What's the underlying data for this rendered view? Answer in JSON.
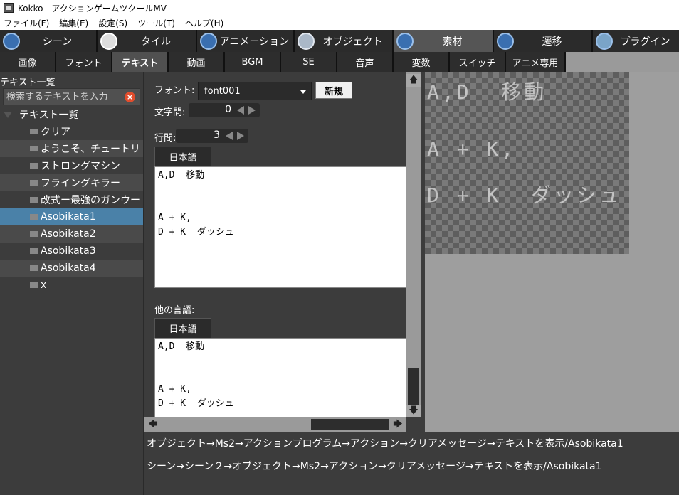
{
  "window": {
    "title": "Kokko - アクションゲームツクールMV"
  },
  "menu": [
    "ファイル(F)",
    "編集(E)",
    "設定(S)",
    "ツール(T)",
    "ヘルプ(H)"
  ],
  "main_tabs": [
    {
      "label": "シーン",
      "icon": "scene-icon"
    },
    {
      "label": "タイル",
      "icon": "tile-icon"
    },
    {
      "label": "アニメーション",
      "icon": "animation-icon"
    },
    {
      "label": "オブジェクト",
      "icon": "object-icon"
    },
    {
      "label": "素材",
      "icon": "assets-icon",
      "active": true
    },
    {
      "label": "遷移",
      "icon": "transition-icon"
    },
    {
      "label": "プラグイン",
      "icon": "plugin-icon"
    }
  ],
  "sub_tabs": [
    {
      "label": "画像"
    },
    {
      "label": "フォント"
    },
    {
      "label": "テキスト",
      "active": true
    },
    {
      "label": "動画"
    },
    {
      "label": "BGM"
    },
    {
      "label": "SE"
    },
    {
      "label": "音声"
    },
    {
      "label": "変数"
    },
    {
      "label": "スイッチ"
    },
    {
      "label": "アニメ専用"
    }
  ],
  "text_list": {
    "title": "テキスト一覧",
    "search_placeholder": "検索するテキストを入力",
    "root_label": "テキスト一覧",
    "items": [
      {
        "label": "クリア"
      },
      {
        "label": "ようこそ、チュートリ"
      },
      {
        "label": "ストロングマシン"
      },
      {
        "label": "フライングキラー"
      },
      {
        "label": "改式ー最強のガンウー"
      },
      {
        "label": "Asobikata1",
        "selected": true
      },
      {
        "label": "Asobikata2"
      },
      {
        "label": "Asobikata3"
      },
      {
        "label": "Asobikata4"
      },
      {
        "label": "x"
      }
    ]
  },
  "editor": {
    "font_label": "フォント:",
    "font_value": "font001",
    "new_button": "新規",
    "char_spacing_label": "文字間:",
    "char_spacing_value": "0",
    "line_spacing_label": "行間:",
    "line_spacing_value": "3",
    "lang_tab": "日本語",
    "text": "A,D  移動\n\n\nA + K,\nD + K  ダッシュ",
    "other_lang_label": "他の言語:",
    "other_lang_tab": "日本語",
    "other_text": "A,D  移動\n\n\nA + K,\nD + K  ダッシュ"
  },
  "preview": {
    "lines": [
      "A,D  移動",
      "A + K,",
      "D + K  ダッシュ"
    ]
  },
  "usages": [
    "オブジェクト→Ms2→アクションプログラム→アクション→クリアメッセージ→テキストを表示/Asobikata1",
    "シーン→シーン２→オブジェクト→Ms2→アクション→クリアメッセージ→テキストを表示/Asobikata1"
  ]
}
